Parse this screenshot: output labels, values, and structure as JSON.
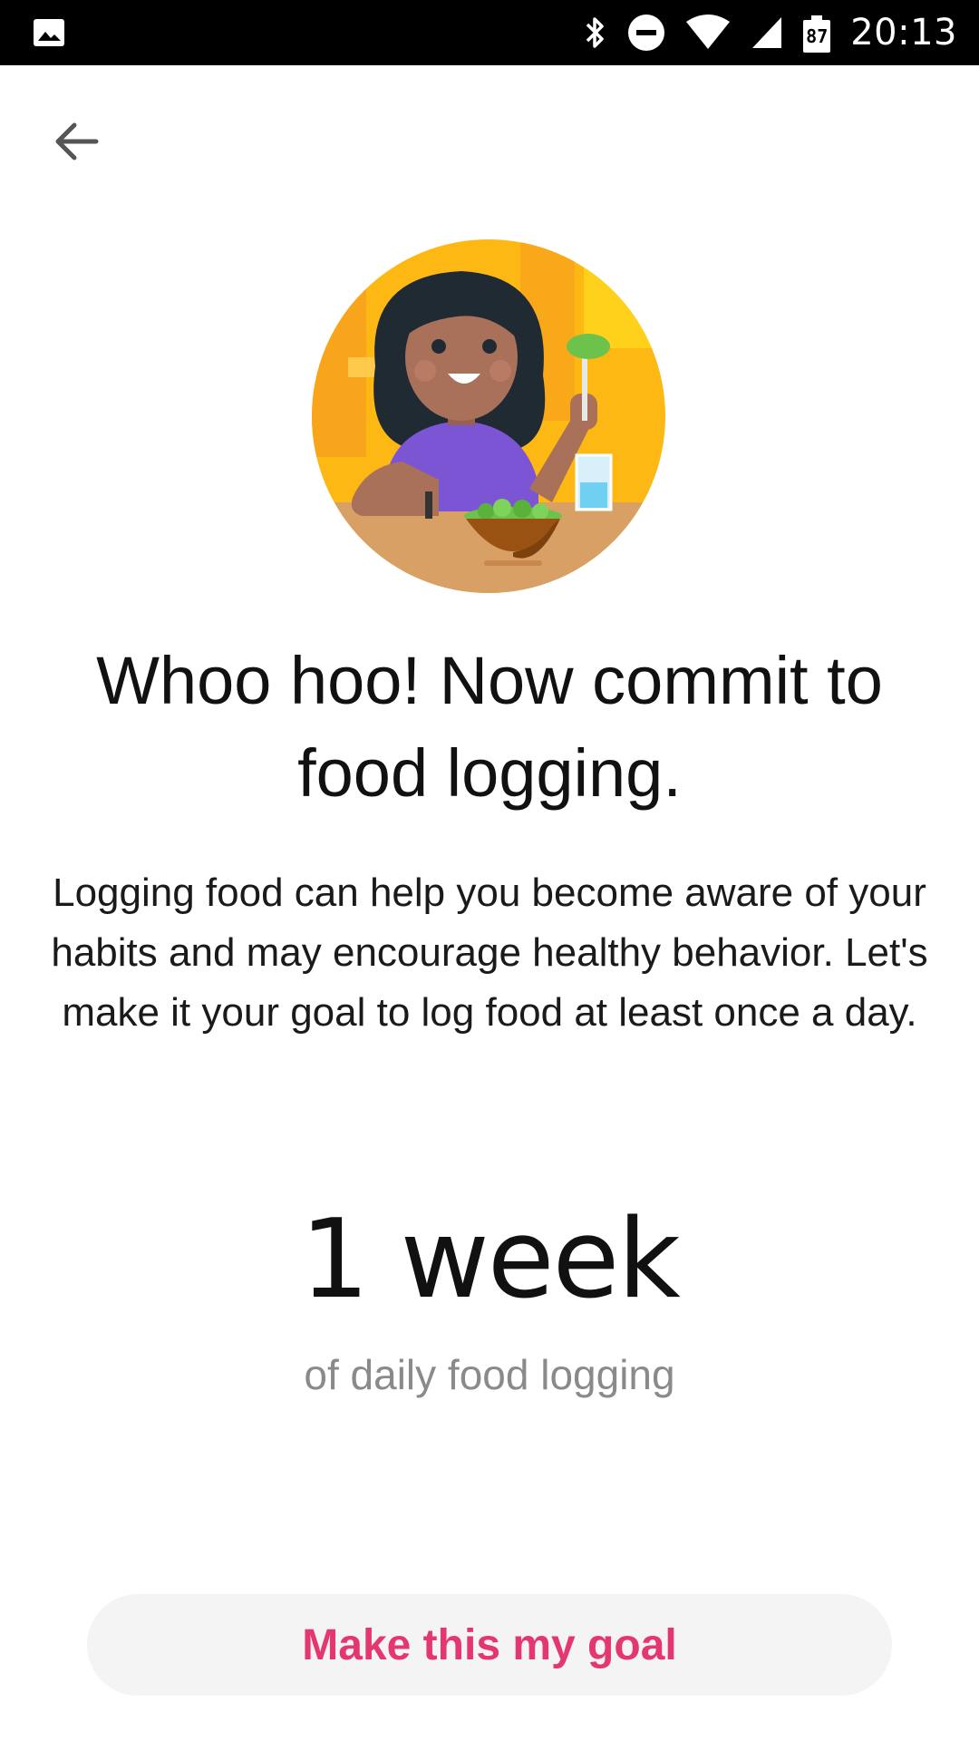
{
  "status_bar": {
    "time": "20:13",
    "battery_level": "87",
    "icons": [
      "image-icon",
      "bluetooth-icon",
      "do-not-disturb-icon",
      "wifi-icon",
      "signal-icon",
      "battery-icon"
    ]
  },
  "nav": {
    "back_icon": "arrow-back-icon"
  },
  "illustration": {
    "icon": "woman-eating-salad-illustration",
    "colors": {
      "circle_bg": "#FDB813",
      "table": "#D9A066",
      "shirt": "#7B55D4",
      "skin": "#A9705A",
      "hair": "#1F2A33",
      "bowl": "#9A5212",
      "salad": "#6CC24A"
    }
  },
  "content": {
    "headline": "Whoo hoo! Now commit to food logging.",
    "body": "Logging food can help you become aware of your habits and may encourage healthy behavior. Let's make it your goal to log food at least once a day.",
    "goal_value": "1 week",
    "goal_caption": "of daily food logging"
  },
  "actions": {
    "primary_label": "Make this my goal"
  },
  "colors": {
    "accent": "#E5376F",
    "button_bg": "#F4F4F4",
    "caption": "#8A8A8A"
  }
}
